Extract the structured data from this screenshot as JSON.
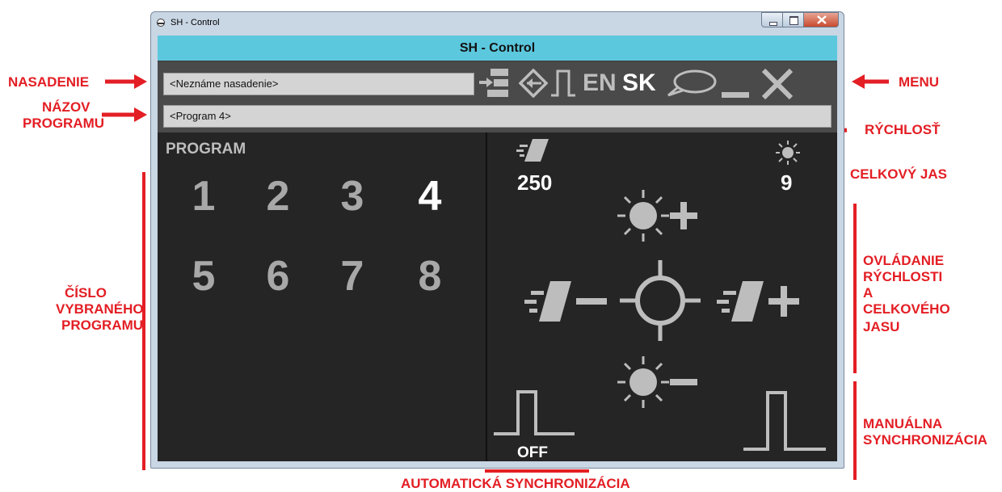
{
  "window": {
    "title": "SH - Control"
  },
  "app": {
    "header_title": "SH - Control",
    "deployment_field": "<Neznáme nasadenie>",
    "program_name_field": "<Program 4>",
    "lang_en": "EN",
    "lang_sk": "SK"
  },
  "program": {
    "label": "PROGRAM",
    "numbers": [
      "1",
      "2",
      "3",
      "4",
      "5",
      "6",
      "7",
      "8"
    ],
    "selected": "4"
  },
  "status": {
    "speed_value": "250",
    "brightness_value": "9",
    "auto_sync_state": "OFF"
  },
  "annotations": {
    "nasadenie": "NASADENIE",
    "nazov_programu_1": "NÁZOV",
    "nazov_programu_2": "PROGRAMU",
    "cislo_1": "ČÍSLO",
    "cislo_2": "VYBRANÉHO",
    "cislo_3": "PROGRAMU",
    "menu": "MENU",
    "rychlost": "RÝCHLOSŤ",
    "celkovy_jas": "CELKOVÝ JAS",
    "ovladanie_1": "OVLÁDANIE",
    "ovladanie_2": "RÝCHLOSTI",
    "ovladanie_3": "A",
    "ovladanie_4": "CELKOVÉHO",
    "ovladanie_5": "JASU",
    "manualna_1": "MANUÁLNA",
    "manualna_2": "SYNCHRONIZÁCIA",
    "automaticka": "AUTOMATICKÁ SYNCHRONIZÁCIA"
  },
  "colors": {
    "annotation_red": "#e31e24",
    "header_cyan": "#5cc8de",
    "panel_dark": "#252525",
    "icon_gray": "#bdbdbd",
    "selected_white": "#ffffff"
  },
  "icons": [
    "deploy-icon",
    "transfer-icon",
    "pulse-icon",
    "chat-icon",
    "minimize-icon",
    "close-icon",
    "speed-icon",
    "brightness-icon"
  ]
}
